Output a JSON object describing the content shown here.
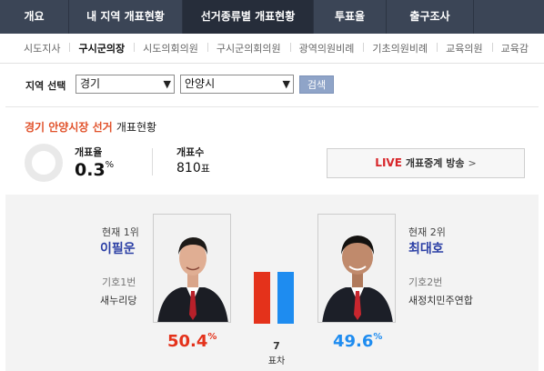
{
  "top_tabs": [
    "개요",
    "내 지역 개표현황",
    "선거종류별 개표현황",
    "투표율",
    "출구조사"
  ],
  "sub_tabs": [
    "시도지사",
    "구시군의장",
    "시도의회의원",
    "구시군의회의원",
    "광역의원비례",
    "기초의원비례",
    "교육의원",
    "교육감"
  ],
  "region": {
    "label": "지역 선택",
    "province": "경기",
    "city": "안양시",
    "search_label": "검색"
  },
  "title": {
    "highlight": "경기 안양시장 선거",
    "rest": "개표현황"
  },
  "stats": {
    "rate_label": "개표율",
    "rate_value": "0.3",
    "rate_unit": "%",
    "count_label": "개표수",
    "count_value": "810",
    "count_unit": "표"
  },
  "live": {
    "tag": "LIVE",
    "text": "개표중계 방송",
    "chevron": ">"
  },
  "candidates": [
    {
      "rank": "현재 1위",
      "name": "이필운",
      "giho": "기호1번",
      "party": "새누리당",
      "pct": "50.4",
      "pct_unit": "%",
      "color": "#e4321b"
    },
    {
      "rank": "현재 2위",
      "name": "최대호",
      "giho": "기호2번",
      "party": "새정치민주연합",
      "pct": "49.6",
      "pct_unit": "%",
      "color": "#1e8cf0"
    }
  ],
  "gap": {
    "value": "7",
    "label": "표차"
  }
}
